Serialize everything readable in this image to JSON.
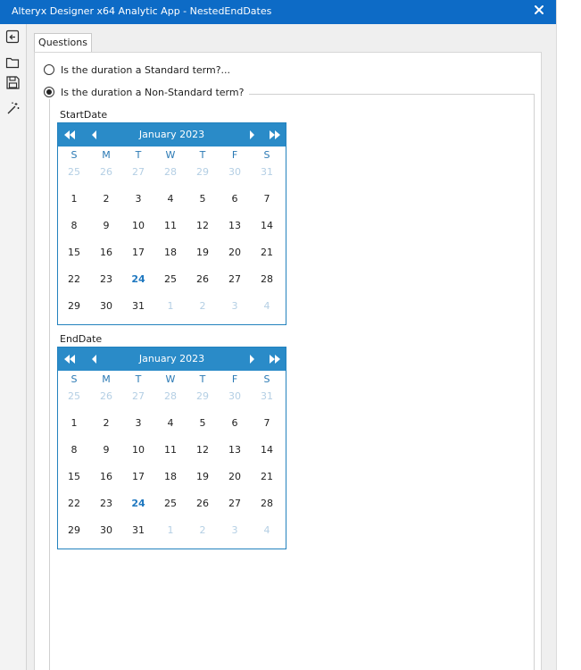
{
  "window": {
    "title": "Alteryx Designer x64 Analytic App - NestedEndDates",
    "close_icon": "close-icon",
    "colors": {
      "titlebar": "#0d6bc6",
      "calendar_header": "#2a8bc8",
      "today": "#1f78c0"
    }
  },
  "toolbar": {
    "items": [
      {
        "name": "back-icon"
      },
      {
        "name": "open-folder-icon"
      },
      {
        "name": "save-icon"
      },
      {
        "name": "magic-wand-icon"
      }
    ]
  },
  "tabs": [
    {
      "label": "Questions"
    }
  ],
  "questions": {
    "option_standard": "Is the duration a Standard term?...",
    "option_nonstandard": "Is the duration a Non-Standard term?",
    "selected": "nonstandard"
  },
  "start_date": {
    "label": "StartDate",
    "month": "January 2023",
    "weekdays": [
      "S",
      "M",
      "T",
      "W",
      "T",
      "F",
      "S"
    ],
    "weeks": [
      [
        "25",
        "26",
        "27",
        "28",
        "29",
        "30",
        "31"
      ],
      [
        "1",
        "2",
        "3",
        "4",
        "5",
        "6",
        "7"
      ],
      [
        "8",
        "9",
        "10",
        "11",
        "12",
        "13",
        "14"
      ],
      [
        "15",
        "16",
        "17",
        "18",
        "19",
        "20",
        "21"
      ],
      [
        "22",
        "23",
        "24",
        "25",
        "26",
        "27",
        "28"
      ],
      [
        "29",
        "30",
        "31",
        "1",
        "2",
        "3",
        "4"
      ]
    ],
    "today": "24"
  },
  "end_date": {
    "label": "EndDate",
    "month": "January 2023",
    "weekdays": [
      "S",
      "M",
      "T",
      "W",
      "T",
      "F",
      "S"
    ],
    "weeks": [
      [
        "25",
        "26",
        "27",
        "28",
        "29",
        "30",
        "31"
      ],
      [
        "1",
        "2",
        "3",
        "4",
        "5",
        "6",
        "7"
      ],
      [
        "8",
        "9",
        "10",
        "11",
        "12",
        "13",
        "14"
      ],
      [
        "15",
        "16",
        "17",
        "18",
        "19",
        "20",
        "21"
      ],
      [
        "22",
        "23",
        "24",
        "25",
        "26",
        "27",
        "28"
      ],
      [
        "29",
        "30",
        "31",
        "1",
        "2",
        "3",
        "4"
      ]
    ],
    "today": "24"
  }
}
